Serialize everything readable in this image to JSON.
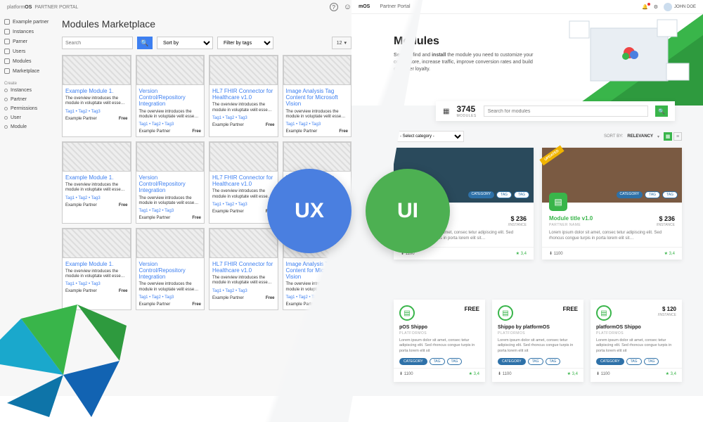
{
  "ux": {
    "brand_prefix": "platform",
    "brand_suffix": "OS",
    "portal": "PARTNER PORTAL",
    "help_icon": "?",
    "user_icon": "👤",
    "nav": [
      {
        "label": "Example partner"
      },
      {
        "label": "Instances"
      },
      {
        "label": "Parner"
      },
      {
        "label": "Users"
      },
      {
        "label": "Modules"
      },
      {
        "label": "Marketplace"
      }
    ],
    "create_heading": "Create",
    "create": [
      {
        "label": "Instances"
      },
      {
        "label": "Partner"
      },
      {
        "label": "Permissions"
      },
      {
        "label": "User"
      },
      {
        "label": "Module"
      }
    ],
    "title": "Modules Marketplace",
    "search_ph": "Search",
    "sort_ph": "Sort by",
    "filter_ph": "Filter by tags",
    "per_page": "12",
    "overview": "The overview introduces the module in voluptate velit esse…",
    "tags": "Tag1 • Tag2 • Tag3",
    "partner": "Example Partner",
    "free": "Free",
    "card_titles": [
      "Example Module 1.",
      "Version Control/Repository Integration",
      "HL7 FHIR Connector for Healthcare v1.0",
      "Image Analysis Tag Content for Microsoft Vision"
    ]
  },
  "ui": {
    "brand": "mOS",
    "crumb": "Partner Portal",
    "user": "JOHN DOE",
    "hero_title": "Modules",
    "hero_text": "Search, find and install the module you need to customize your online store, increase traffic, improve conversion rates and build customer loyalty.",
    "hero_strong": "Search",
    "count": "3745",
    "count_label": "MODULES",
    "search_ph": "Search for modules",
    "category_ph": "- Select category -",
    "sort_label": "SORT BY:",
    "sort_value": "RELEVANCY",
    "ribbon": "UPDATED",
    "featured": [
      {
        "title": "Module title v1.0",
        "partner": "PARTNER NAME",
        "price": "$ 236",
        "unit": "/INSTANCE",
        "desc": "Lorem ipsum dolor sit amet, consec tetur adipiscing elit. Sed rhoncus congue turpis in porta lorem elit sit…",
        "downloads": "1100",
        "rating": "3,4",
        "img": "#2a4a5c"
      },
      {
        "title": "Module title v1.0",
        "partner": "PARTNER NAME",
        "price": "$ 236",
        "unit": "/INSTANCE",
        "desc": "Lorem ipsum dolor sit amet, consec tetur adipiscing elit. Sed rhoncus congue turpis in porta lorem elit sit…",
        "downloads": "1100",
        "rating": "3,4",
        "img": "#7a5a42"
      }
    ],
    "pills": {
      "cat": "CATEGORY",
      "tag": "TAG"
    },
    "cards": [
      {
        "title": "pOS Shippo",
        "partner": "PLATFORMOS",
        "price": "FREE",
        "unit": "",
        "desc": "Lorem ipsum dolor sit amet, consec tetur adipiscing elit. Sed rhoncus congue turpis in porta lorem elit sit",
        "downloads": "1100",
        "rating": "3,4"
      },
      {
        "title": "Shippo by platformOS",
        "partner": "PLATFORMOS",
        "price": "FREE",
        "unit": "",
        "desc": "Lorem ipsum dolor sit amet, consec tetur adipiscing elit. Sed rhoncus congue turpis in porta lorem elit sit",
        "downloads": "1100",
        "rating": "3,4"
      },
      {
        "title": "platformOS Shippo",
        "partner": "PLATFORMOS",
        "price": "$ 120",
        "unit": "/INSTANCE",
        "desc": "Lorem ipsum dolor sit amet, consec tetur adipiscing elit. Sed rhoncus congue turpis in porta lorem elit sit",
        "downloads": "1100",
        "rating": "3,4"
      }
    ]
  },
  "badges": {
    "ux": "UX",
    "ui": "UI"
  }
}
